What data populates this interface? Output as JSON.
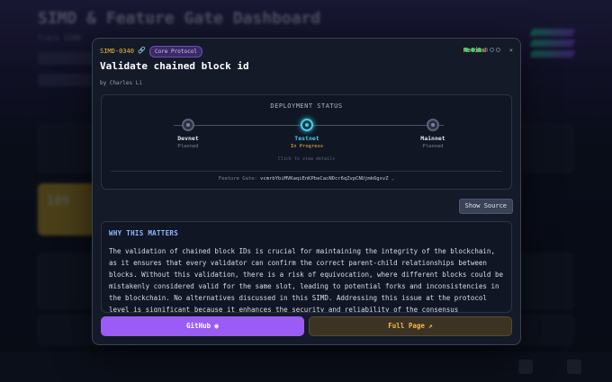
{
  "background": {
    "title": "SIMD & Feature Gate Dashboard",
    "subtitle": "Track SIMD",
    "yellow_card_value": "109"
  },
  "modal": {
    "simd_id": "SIMD-0340",
    "category_tag": "Core Protocol",
    "title": "Validate chained block id",
    "author": "by Charles Li",
    "status_label": "Review",
    "progress_dots": {
      "filled": 3,
      "total": 6
    },
    "close_label": "×",
    "deployment": {
      "title": "DEPLOYMENT STATUS",
      "stages": [
        {
          "name": "Devnet",
          "status": "Planned"
        },
        {
          "name": "Testnet",
          "status": "In Progress"
        },
        {
          "name": "Mainnet",
          "status": "Planned"
        }
      ],
      "click_hint": "Click to view details",
      "feature_gate_label": "Feature Gate:",
      "feature_gate_value": "vcmrbYbiMVKaqiEnKPbeCacNDcr6qZvpCNUjmk6gsvZ"
    },
    "show_source_label": "Show Source",
    "why": {
      "title": "WHY THIS MATTERS",
      "text": "The validation of chained block IDs is crucial for maintaining the integrity of the blockchain, as it ensures that every validator can confirm the correct parent-child relationships between blocks. Without this validation, there is a risk of equivocation, where different blocks could be mistakenly considered valid for the same slot, leading to potential forks and inconsistencies in the blockchain. No alternatives discussed in this SIMD. Addressing this issue at the protocol level is significant because it enhances the security and reliability of the consensus mechanisms,"
    },
    "buttons": {
      "github": "GitHub",
      "full_page": "Full Page"
    }
  },
  "colors": {
    "accent_purple": "#9b5cf5",
    "accent_gold": "#f2b84b",
    "active_stage": "#3fd0e8",
    "status_orange": "#f39a3a",
    "dot_green": "#3ad07a"
  }
}
